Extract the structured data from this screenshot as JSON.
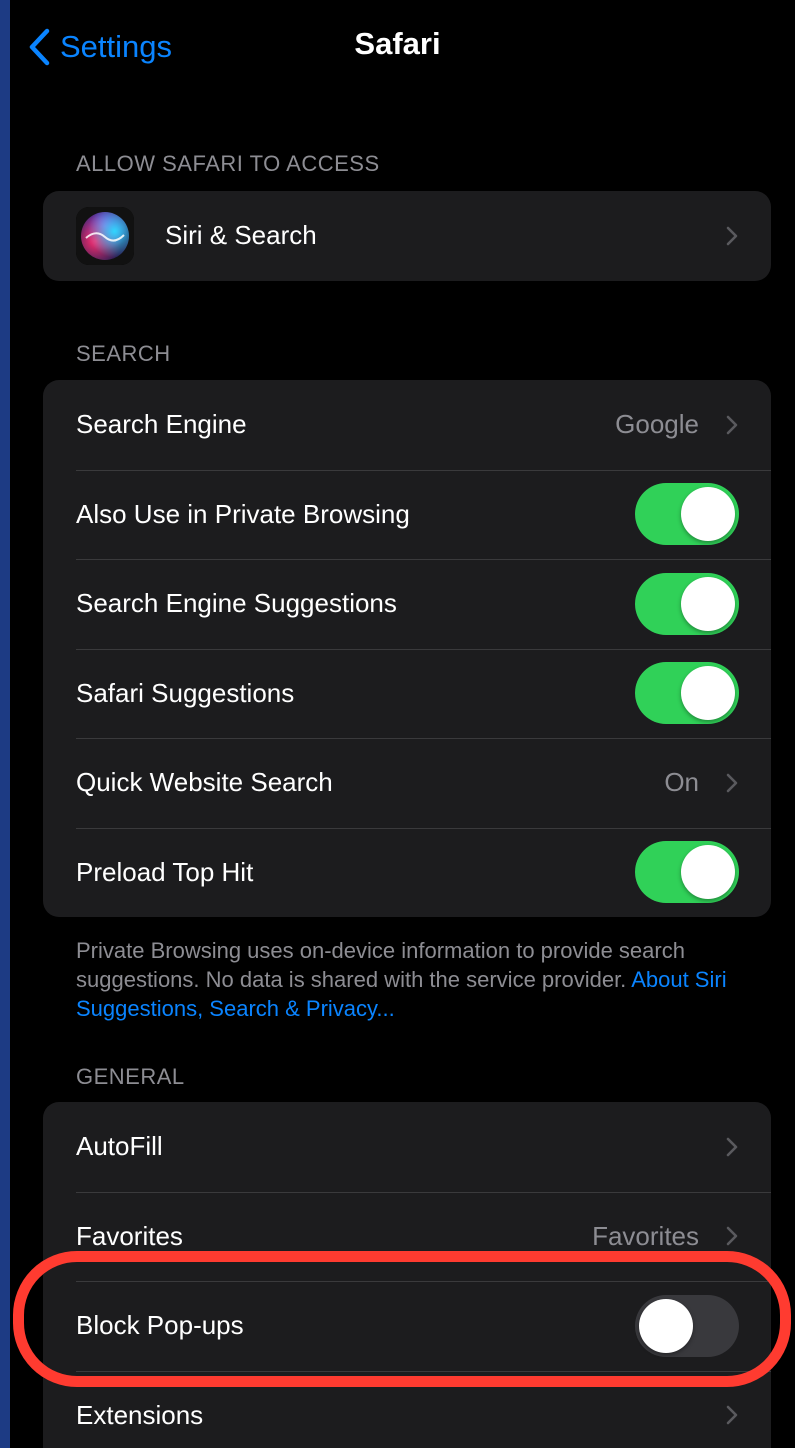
{
  "nav": {
    "back_label": "Settings",
    "title": "Safari"
  },
  "sections": {
    "access": {
      "header": "ALLOW SAFARI TO ACCESS",
      "siri_label": "Siri & Search"
    },
    "search": {
      "header": "SEARCH",
      "search_engine": {
        "label": "Search Engine",
        "value": "Google"
      },
      "private_browsing": {
        "label": "Also Use in Private Browsing",
        "on": true
      },
      "engine_suggestions": {
        "label": "Search Engine Suggestions",
        "on": true
      },
      "safari_suggestions": {
        "label": "Safari Suggestions",
        "on": true
      },
      "quick_website_search": {
        "label": "Quick Website Search",
        "value": "On"
      },
      "preload_top_hit": {
        "label": "Preload Top Hit",
        "on": true
      },
      "footnote_text": "Private Browsing uses on-device information to provide search suggestions. No data is shared with the service provider. ",
      "footnote_link": "About Siri Suggestions, Search & Privacy..."
    },
    "general": {
      "header": "GENERAL",
      "autofill": {
        "label": "AutoFill"
      },
      "favorites": {
        "label": "Favorites",
        "value": "Favorites"
      },
      "block_popups": {
        "label": "Block Pop-ups",
        "on": false
      },
      "extensions": {
        "label": "Extensions"
      }
    }
  },
  "colors": {
    "accent": "#0a84ff",
    "toggle_on": "#30d158",
    "toggle_off": "#39393d",
    "highlight": "#ff3b30",
    "cell_background": "#1c1c1e",
    "outer_background": "#1d3b84"
  },
  "icons": {
    "back": "chevron-left-icon",
    "disclosure": "chevron-right-icon",
    "siri": "siri-icon"
  }
}
